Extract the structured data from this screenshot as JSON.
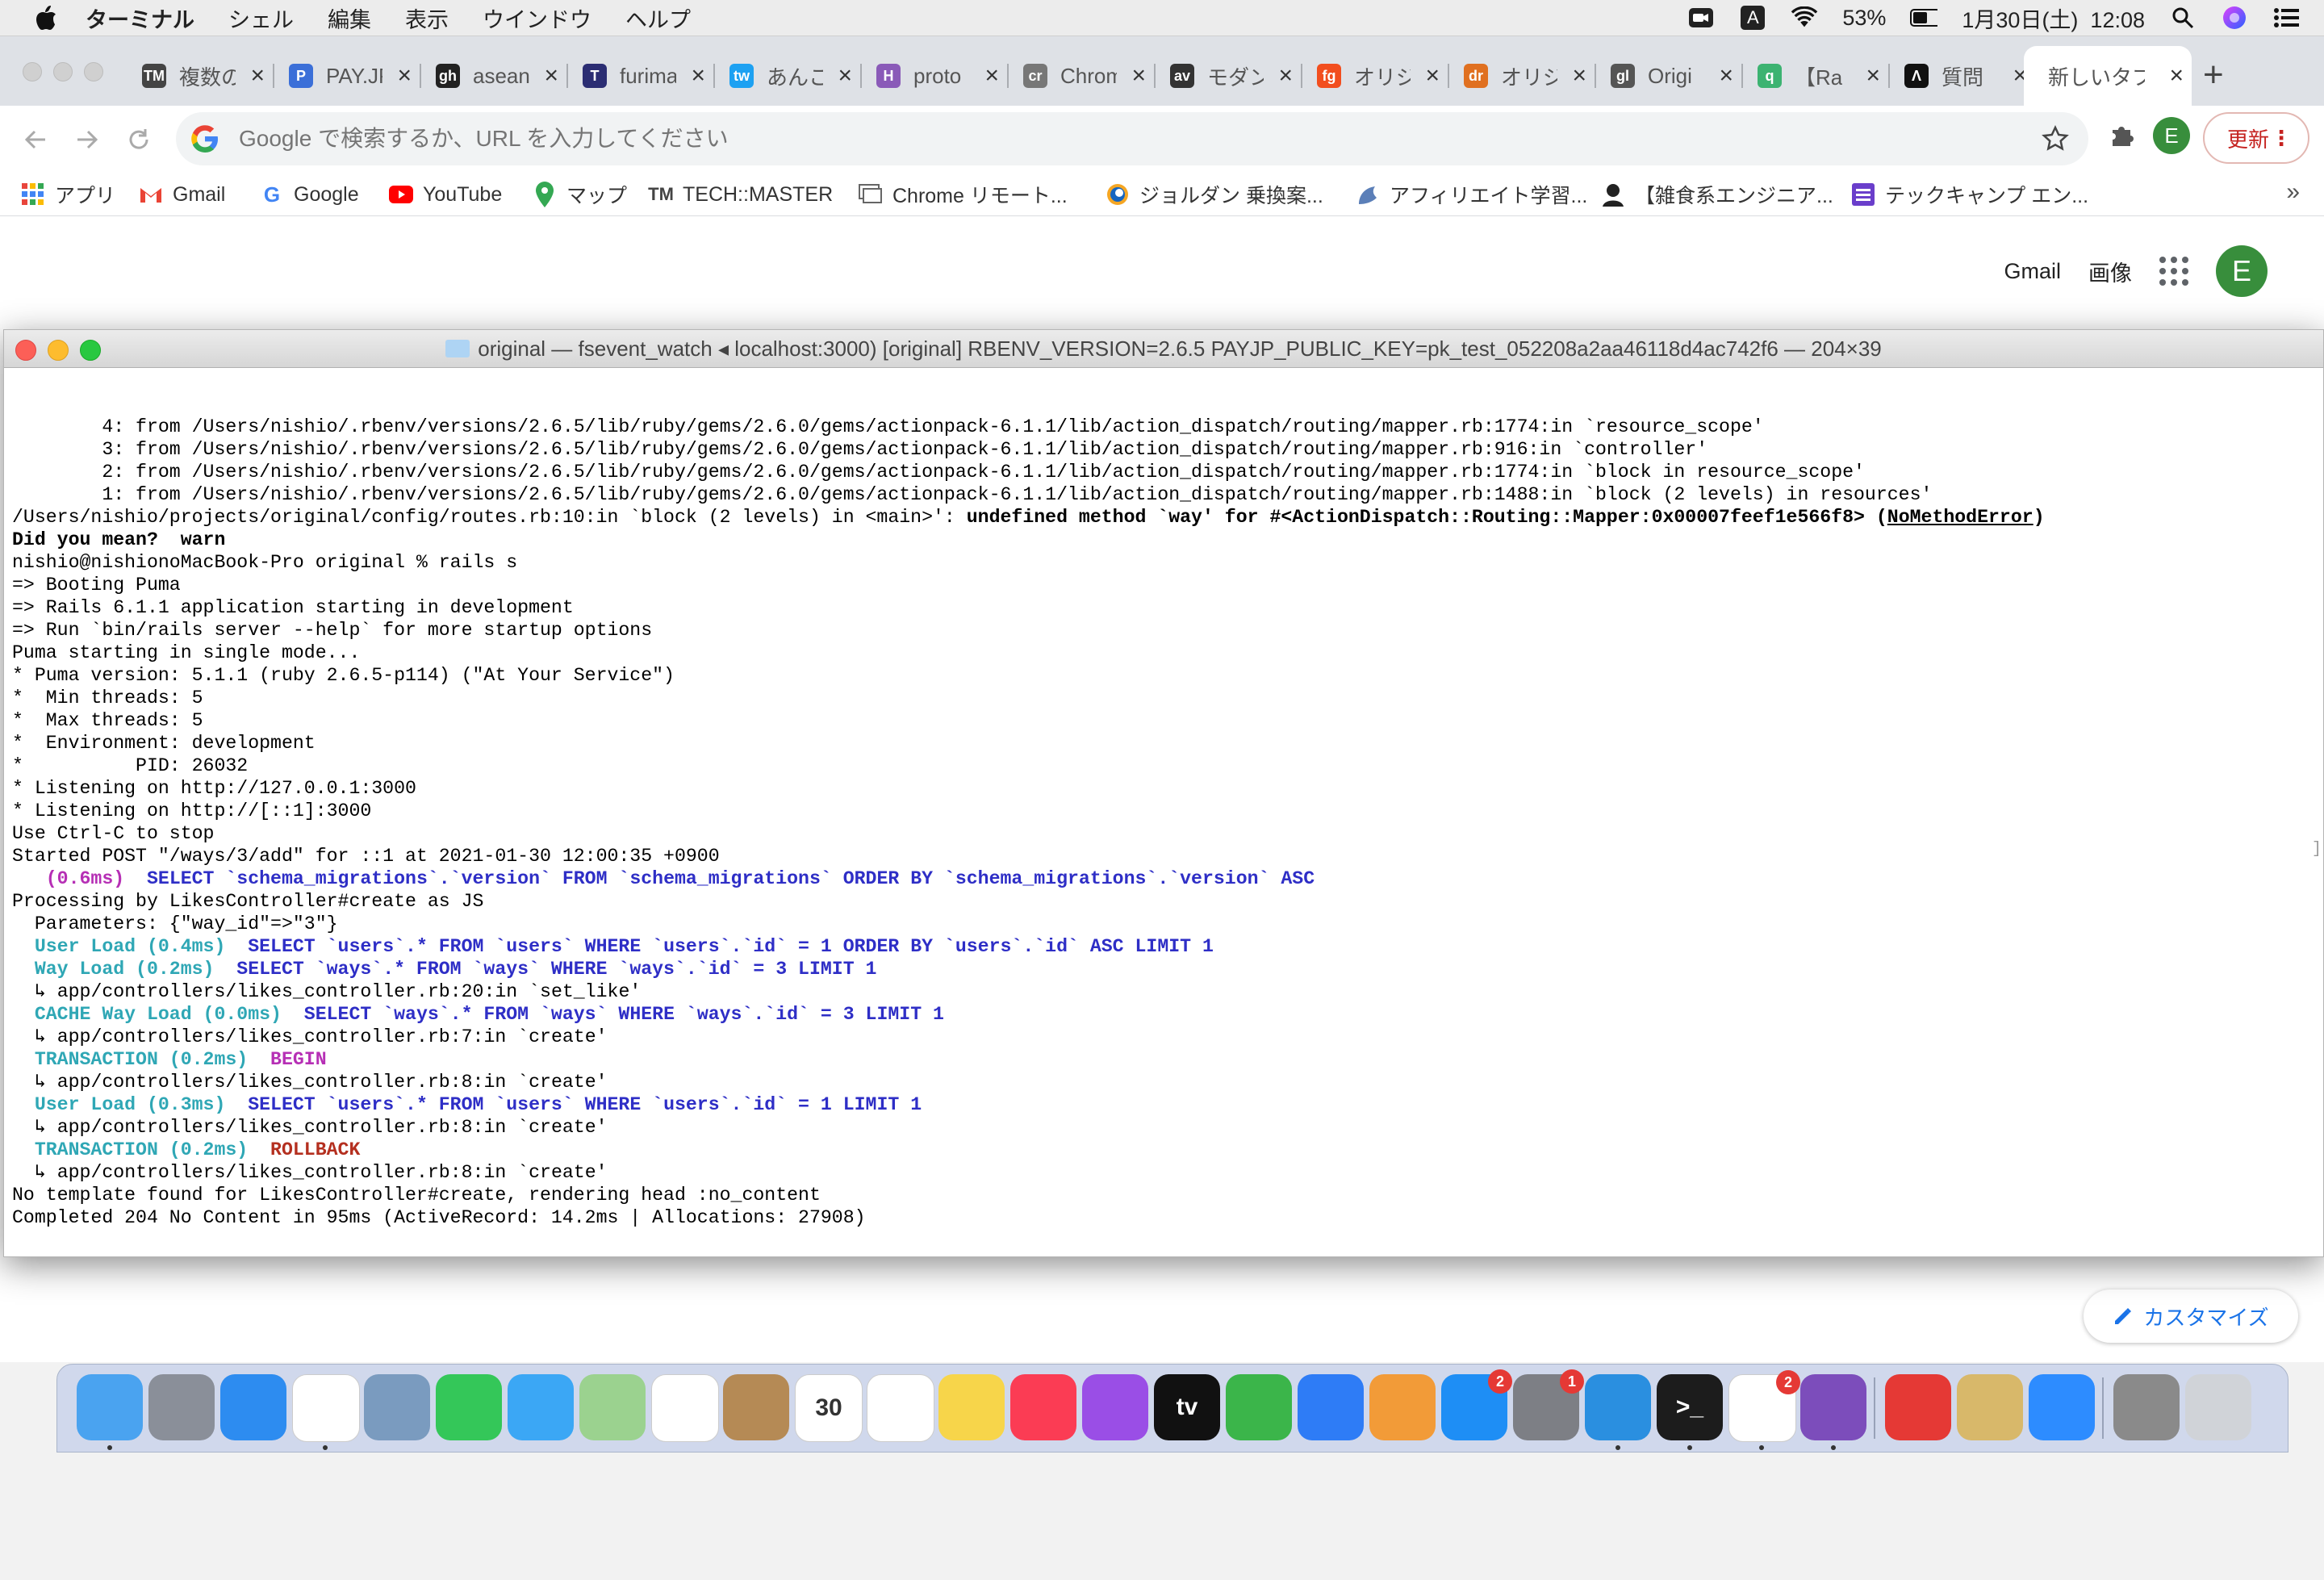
{
  "menubar": {
    "app_name": "ターミナル",
    "menus": [
      "シェル",
      "編集",
      "表示",
      "ウインドウ",
      "ヘルプ"
    ],
    "input_indicator": "A",
    "battery": "53%",
    "datetime": "1月30日(土)  12:08"
  },
  "browser": {
    "tabs": [
      {
        "title": "複数の",
        "favicon": "TM",
        "color": "#444444"
      },
      {
        "title": "PAY.JP",
        "favicon": "P",
        "color": "#3b6fd8"
      },
      {
        "title": "asean",
        "favicon": "gh",
        "color": "#222222"
      },
      {
        "title": "furima",
        "favicon": "T",
        "color": "#2b2d73"
      },
      {
        "title": "あんこ",
        "favicon": "tw",
        "color": "#1da1f2"
      },
      {
        "title": "proto",
        "favicon": "H",
        "color": "#8a5ab8"
      },
      {
        "title": "Chrome",
        "favicon": "cr",
        "color": "#777777"
      },
      {
        "title": "モダン",
        "favicon": "av",
        "color": "#333333"
      },
      {
        "title": "オリジ",
        "favicon": "fg",
        "color": "#f24e1e"
      },
      {
        "title": "オリジ",
        "favicon": "dr",
        "color": "#e07020"
      },
      {
        "title": "Origi",
        "favicon": "gl",
        "color": "#555555"
      },
      {
        "title": "【Ra",
        "favicon": "q",
        "color": "#3cb371"
      },
      {
        "title": "質問",
        "favicon": "Λ",
        "color": "#111111"
      },
      {
        "title": "新しいタブ",
        "favicon": "",
        "color": "#ffffff"
      }
    ],
    "omnibox_placeholder": "Google で検索するか、URL を入力してください",
    "profile_initial": "E",
    "update_label": "更新",
    "bookmarks": [
      {
        "label": "アプリ",
        "icon": "apps-icon"
      },
      {
        "label": "Gmail",
        "icon": "gmail-icon"
      },
      {
        "label": "Google",
        "icon": "google-icon"
      },
      {
        "label": "YouTube",
        "icon": "youtube-icon"
      },
      {
        "label": "マップ",
        "icon": "maps-icon"
      },
      {
        "label": "TECH::MASTER",
        "icon": "techmaster-icon"
      },
      {
        "label": "Chrome リモート...",
        "icon": "chrome-remote-icon"
      },
      {
        "label": "ジョルダン 乗換案...",
        "icon": "jorudan-icon"
      },
      {
        "label": "アフィリエイト学習...",
        "icon": "affiliate-icon"
      },
      {
        "label": "【雑食系エンジニア...",
        "icon": "engineer-icon"
      },
      {
        "label": "テックキャンプ エン...",
        "icon": "techcamp-icon"
      }
    ],
    "more_bookmarks": "»"
  },
  "google": {
    "gmail": "Gmail",
    "images": "画像",
    "profile_initial": "E",
    "customize": "カスタマイズ"
  },
  "terminal": {
    "title": "original — fsevent_watch ◂ localhost:3000) [original] RBENV_VERSION=2.6.5 PAYJP_PUBLIC_KEY=pk_test_052208a2aa46118d4ac742f6 — 204×39",
    "lines": [
      {
        "segs": [
          {
            "t": "        4: from /Users/nishio/.rbenv/versions/2.6.5/lib/ruby/gems/2.6.0/gems/actionpack-6.1.1/lib/action_dispatch/routing/mapper.rb:1774:in `resource_scope'",
            "c": ""
          }
        ]
      },
      {
        "segs": [
          {
            "t": "        3: from /Users/nishio/.rbenv/versions/2.6.5/lib/ruby/gems/2.6.0/gems/actionpack-6.1.1/lib/action_dispatch/routing/mapper.rb:916:in `controller'",
            "c": ""
          }
        ]
      },
      {
        "segs": [
          {
            "t": "        2: from /Users/nishio/.rbenv/versions/2.6.5/lib/ruby/gems/2.6.0/gems/actionpack-6.1.1/lib/action_dispatch/routing/mapper.rb:1774:in `block in resource_scope'",
            "c": ""
          }
        ]
      },
      {
        "segs": [
          {
            "t": "        1: from /Users/nishio/.rbenv/versions/2.6.5/lib/ruby/gems/2.6.0/gems/actionpack-6.1.1/lib/action_dispatch/routing/mapper.rb:1488:in `block (2 levels) in resources'",
            "c": ""
          }
        ]
      },
      {
        "segs": [
          {
            "t": "/Users/nishio/projects/original/config/routes.rb:10:in `block (2 levels) in <main>': ",
            "c": ""
          },
          {
            "t": "undefined method `way' for #<ActionDispatch::Routing::Mapper:0x00007feef1e566f8> (",
            "c": "b"
          },
          {
            "t": "NoMethodError",
            "c": "b ul"
          },
          {
            "t": ")",
            "c": "b"
          }
        ]
      },
      {
        "segs": [
          {
            "t": "Did you mean?  warn",
            "c": "b"
          }
        ]
      },
      {
        "segs": [
          {
            "t": "nishio@nishionoMacBook-Pro original % rails s",
            "c": ""
          }
        ]
      },
      {
        "segs": [
          {
            "t": "=> Booting Puma",
            "c": ""
          }
        ]
      },
      {
        "segs": [
          {
            "t": "=> Rails 6.1.1 application starting in development",
            "c": ""
          }
        ]
      },
      {
        "segs": [
          {
            "t": "=> Run `bin/rails server --help` for more startup options",
            "c": ""
          }
        ]
      },
      {
        "segs": [
          {
            "t": "Puma starting in single mode...",
            "c": ""
          }
        ]
      },
      {
        "segs": [
          {
            "t": "* Puma version: 5.1.1 (ruby 2.6.5-p114) (\"At Your Service\")",
            "c": ""
          }
        ]
      },
      {
        "segs": [
          {
            "t": "*  Min threads: 5",
            "c": ""
          }
        ]
      },
      {
        "segs": [
          {
            "t": "*  Max threads: 5",
            "c": ""
          }
        ]
      },
      {
        "segs": [
          {
            "t": "*  Environment: development",
            "c": ""
          }
        ]
      },
      {
        "segs": [
          {
            "t": "*          PID: 26032",
            "c": ""
          }
        ]
      },
      {
        "segs": [
          {
            "t": "* Listening on http://127.0.0.1:3000",
            "c": ""
          }
        ]
      },
      {
        "segs": [
          {
            "t": "* Listening on http://[::1]:3000",
            "c": ""
          }
        ]
      },
      {
        "segs": [
          {
            "t": "Use Ctrl-C to stop",
            "c": ""
          }
        ]
      },
      {
        "segs": [
          {
            "t": "Started POST \"/ways/3/add\" for ::1 at 2021-01-30 12:00:35 +0900",
            "c": ""
          }
        ]
      },
      {
        "segs": [
          {
            "t": "   (0.6ms)  ",
            "c": "sql-t"
          },
          {
            "t": "SELECT `schema_migrations`.`version` FROM `schema_migrations` ORDER BY `schema_migrations`.`version` ASC",
            "c": "sql"
          }
        ]
      },
      {
        "segs": [
          {
            "t": "Processing by LikesController#create as JS",
            "c": ""
          }
        ]
      },
      {
        "segs": [
          {
            "t": "  Parameters: {\"way_id\"=>\"3\"}",
            "c": ""
          }
        ]
      },
      {
        "segs": [
          {
            "t": "  User Load (0.4ms)  ",
            "c": "cy"
          },
          {
            "t": "SELECT `users`.* FROM `users` WHERE `users`.`id` = 1 ORDER BY `users`.`id` ASC LIMIT 1",
            "c": "sql"
          }
        ]
      },
      {
        "segs": [
          {
            "t": "  Way Load (0.2ms)  ",
            "c": "cy"
          },
          {
            "t": "SELECT `ways`.* FROM `ways` WHERE `ways`.`id` = 3 LIMIT 1",
            "c": "sql"
          }
        ]
      },
      {
        "segs": [
          {
            "t": "  ↳ app/controllers/likes_controller.rb:20:in `set_like'",
            "c": ""
          }
        ]
      },
      {
        "segs": [
          {
            "t": "  CACHE Way Load (0.0ms)  ",
            "c": "cy"
          },
          {
            "t": "SELECT `ways`.* FROM `ways` WHERE `ways`.`id` = 3 LIMIT 1",
            "c": "sql"
          }
        ]
      },
      {
        "segs": [
          {
            "t": "  ↳ app/controllers/likes_controller.rb:7:in `create'",
            "c": ""
          }
        ]
      },
      {
        "segs": [
          {
            "t": "  TRANSACTION (0.2ms)  ",
            "c": "cy"
          },
          {
            "t": "BEGIN",
            "c": "mag"
          }
        ]
      },
      {
        "segs": [
          {
            "t": "  ↳ app/controllers/likes_controller.rb:8:in `create'",
            "c": ""
          }
        ]
      },
      {
        "segs": [
          {
            "t": "  User Load (0.3ms)  ",
            "c": "cy"
          },
          {
            "t": "SELECT `users`.* FROM `users` WHERE `users`.`id` = 1 LIMIT 1",
            "c": "sql"
          }
        ]
      },
      {
        "segs": [
          {
            "t": "  ↳ app/controllers/likes_controller.rb:8:in `create'",
            "c": ""
          }
        ]
      },
      {
        "segs": [
          {
            "t": "  TRANSACTION (0.2ms)  ",
            "c": "cy"
          },
          {
            "t": "ROLLBACK",
            "c": "red"
          }
        ]
      },
      {
        "segs": [
          {
            "t": "  ↳ app/controllers/likes_controller.rb:8:in `create'",
            "c": ""
          }
        ]
      },
      {
        "segs": [
          {
            "t": "No template found for LikesController#create, rendering head :no_content",
            "c": ""
          }
        ]
      },
      {
        "segs": [
          {
            "t": "Completed 204 No Content in 95ms (ActiveRecord: 14.2ms | Allocations: 27908)",
            "c": ""
          }
        ]
      }
    ]
  },
  "dock": {
    "apps": [
      {
        "name": "finder",
        "label": "",
        "bg": "#4aa3f0",
        "running": true
      },
      {
        "name": "launchpad",
        "label": "",
        "bg": "#8a8f99",
        "running": false
      },
      {
        "name": "safari",
        "label": "",
        "bg": "#2d8cf0",
        "running": false
      },
      {
        "name": "chrome",
        "label": "",
        "bg": "#ffffff",
        "running": true
      },
      {
        "name": "preview",
        "label": "",
        "bg": "#7a9bbf",
        "running": false
      },
      {
        "name": "facetime",
        "label": "",
        "bg": "#34c759",
        "running": false
      },
      {
        "name": "messages",
        "label": "",
        "bg": "#3ba7f5",
        "running": false
      },
      {
        "name": "maps",
        "label": "",
        "bg": "#9bd28f",
        "running": false
      },
      {
        "name": "photos",
        "label": "",
        "bg": "#ffffff",
        "running": false
      },
      {
        "name": "contacts",
        "label": "",
        "bg": "#b58a55",
        "running": false
      },
      {
        "name": "calendar",
        "label": "30",
        "bg": "#ffffff",
        "running": false
      },
      {
        "name": "reminders",
        "label": "",
        "bg": "#ffffff",
        "running": false
      },
      {
        "name": "notes",
        "label": "",
        "bg": "#f7d54a",
        "running": false
      },
      {
        "name": "music",
        "label": "",
        "bg": "#fb3c54",
        "running": false
      },
      {
        "name": "podcasts",
        "label": "",
        "bg": "#9a4ee6",
        "running": false
      },
      {
        "name": "appletv",
        "label": "tv",
        "bg": "#111111",
        "running": false
      },
      {
        "name": "numbers",
        "label": "",
        "bg": "#3bb54a",
        "running": false
      },
      {
        "name": "keynote",
        "label": "",
        "bg": "#2e7cf6",
        "running": false
      },
      {
        "name": "pages",
        "label": "",
        "bg": "#f29b38",
        "running": false
      },
      {
        "name": "appstore",
        "label": "",
        "bg": "#1e8ef5",
        "running": false,
        "badge": "2"
      },
      {
        "name": "system-preferences",
        "label": "",
        "bg": "#7d7f85",
        "running": false,
        "badge": "1"
      },
      {
        "name": "vscode",
        "label": "",
        "bg": "#2a8fe0",
        "running": true
      },
      {
        "name": "terminal",
        "label": ">_",
        "bg": "#1c1c1c",
        "running": true
      },
      {
        "name": "slack",
        "label": "",
        "bg": "#ffffff",
        "running": true,
        "badge": "2"
      },
      {
        "name": "github-desktop",
        "label": "",
        "bg": "#7c4dbb",
        "running": true
      },
      {
        "name": "mail-app",
        "label": "",
        "bg": "#e53935",
        "running": false
      },
      {
        "name": "sequel",
        "label": "",
        "bg": "#d8b86a",
        "running": false
      },
      {
        "name": "zoom",
        "label": "",
        "bg": "#2d8cff",
        "running": false
      },
      {
        "name": "screenshot",
        "label": "",
        "bg": "#8a8a8a",
        "running": false
      },
      {
        "name": "trash",
        "label": "",
        "bg": "#d0d3d8",
        "running": false
      }
    ]
  }
}
